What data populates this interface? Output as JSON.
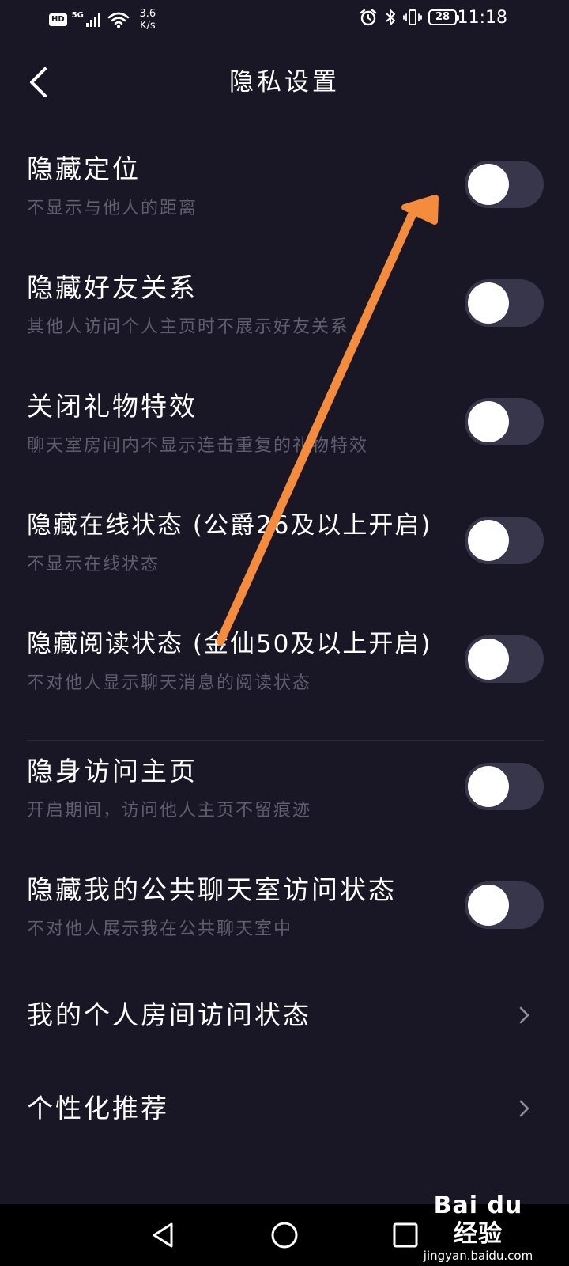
{
  "status_bar": {
    "hd": "HD",
    "network": "5G",
    "speed_value": "3.6",
    "speed_unit": "K/s",
    "battery": "28",
    "time": "11:18"
  },
  "header": {
    "title": "隐私设置"
  },
  "settings_group_1": [
    {
      "title": "隐藏定位",
      "desc": "不显示与他人的距离",
      "enabled": false
    },
    {
      "title": "隐藏好友关系",
      "desc": "其他人访问个人主页时不展示好友关系",
      "enabled": false
    },
    {
      "title": "关闭礼物特效",
      "desc": "聊天室房间内不显示连击重复的礼物特效",
      "enabled": false
    },
    {
      "title": "隐藏在线状态 (公爵26及以上开启)",
      "desc": "不显示在线状态",
      "enabled": false
    },
    {
      "title": "隐藏阅读状态 (金仙50及以上开启)",
      "desc": "不对他人显示聊天消息的阅读状态",
      "enabled": false
    }
  ],
  "settings_group_2": [
    {
      "title": "隐身访问主页",
      "desc": "开启期间，访问他人主页不留痕迹",
      "enabled": false
    },
    {
      "title": "隐藏我的公共聊天室访问状态",
      "desc": "不对他人展示我在公共聊天室中",
      "enabled": false
    }
  ],
  "nav_items": [
    {
      "label": "我的个人房间访问状态"
    },
    {
      "label": "个性化推荐"
    }
  ],
  "annotation": {
    "arrow_color": "#f58b3c"
  },
  "watermark": {
    "logo": "Bai du 经验",
    "url": "jingyan.baidu.com"
  },
  "colors": {
    "background": "#191726",
    "toggle_off": "#38364a",
    "desc_text": "#5f5d6e"
  }
}
